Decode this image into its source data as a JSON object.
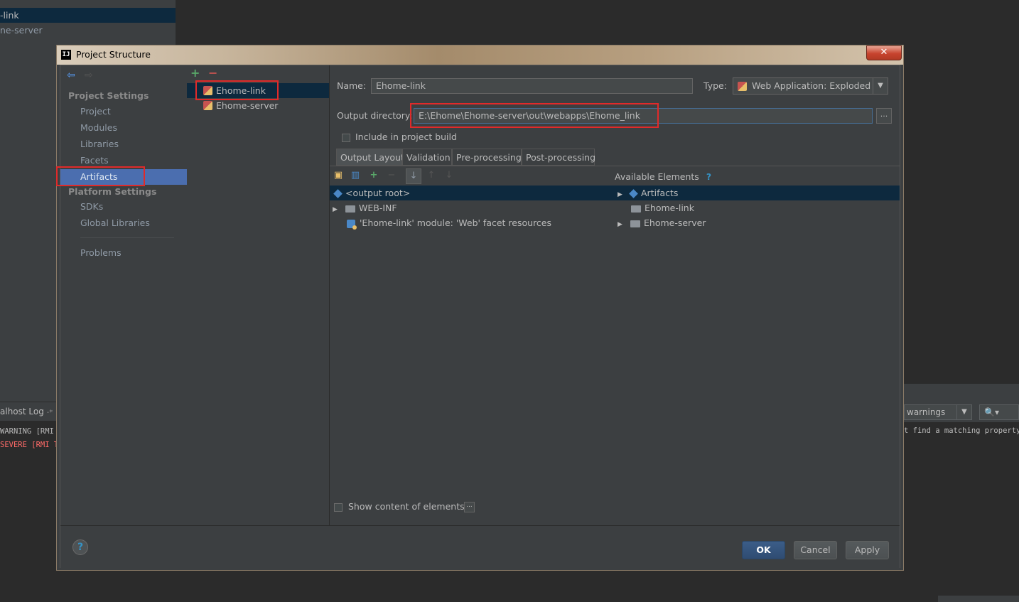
{
  "background": {
    "tree_rows": [
      "-link",
      "ne-server"
    ],
    "log_tab": "alhost Log",
    "log_tab_suffix": "-* ×",
    "log_lines": [
      "WARNING [RMI",
      "SEVERE [RMI T"
    ],
    "filter_value": "warnings",
    "right_log_line": "t find a matching property."
  },
  "dialog": {
    "title": "Project Structure",
    "app_icon": "IJ"
  },
  "nav": {
    "project_settings_header": "Project Settings",
    "project_settings_items": [
      "Project",
      "Modules",
      "Libraries",
      "Facets",
      "Artifacts"
    ],
    "selected": "Artifacts",
    "platform_settings_header": "Platform Settings",
    "platform_settings_items": [
      "SDKs",
      "Global Libraries"
    ],
    "problems": "Problems"
  },
  "artifacts": {
    "items": [
      "Ehome-link",
      "Ehome-server"
    ],
    "selected": "Ehome-link"
  },
  "config": {
    "name_label": "Name:",
    "name_value": "Ehome-link",
    "type_label": "Type:",
    "type_value": "Web Application: Exploded",
    "output_dir_label": "Output directory:",
    "output_dir_value": "E:\\Ehome\\Ehome-server\\out\\webapps\\Ehome_link",
    "browse_label": "...",
    "include_in_build_label": "Include in project build",
    "tabs": [
      "Output Layout",
      "Validation",
      "Pre-processing",
      "Post-processing"
    ],
    "active_tab": "Output Layout",
    "available_elements_label": "Available Elements",
    "available_help": "?",
    "layout_tree": [
      "<output root>",
      "WEB-INF",
      "'Ehome-link' module: 'Web' facet resources"
    ],
    "available_tree": [
      "Artifacts",
      "Ehome-link",
      "Ehome-server"
    ],
    "show_content_label": "Show content of elements",
    "show_content_btn": "..."
  },
  "footer": {
    "help": "?",
    "ok": "OK",
    "cancel": "Cancel",
    "apply": "Apply"
  },
  "colors": {
    "selection": "#4b6eaf",
    "tree_selection": "#0d293e",
    "highlight": "#e02a2a",
    "add": "#59a869",
    "remove": "#c75450"
  }
}
